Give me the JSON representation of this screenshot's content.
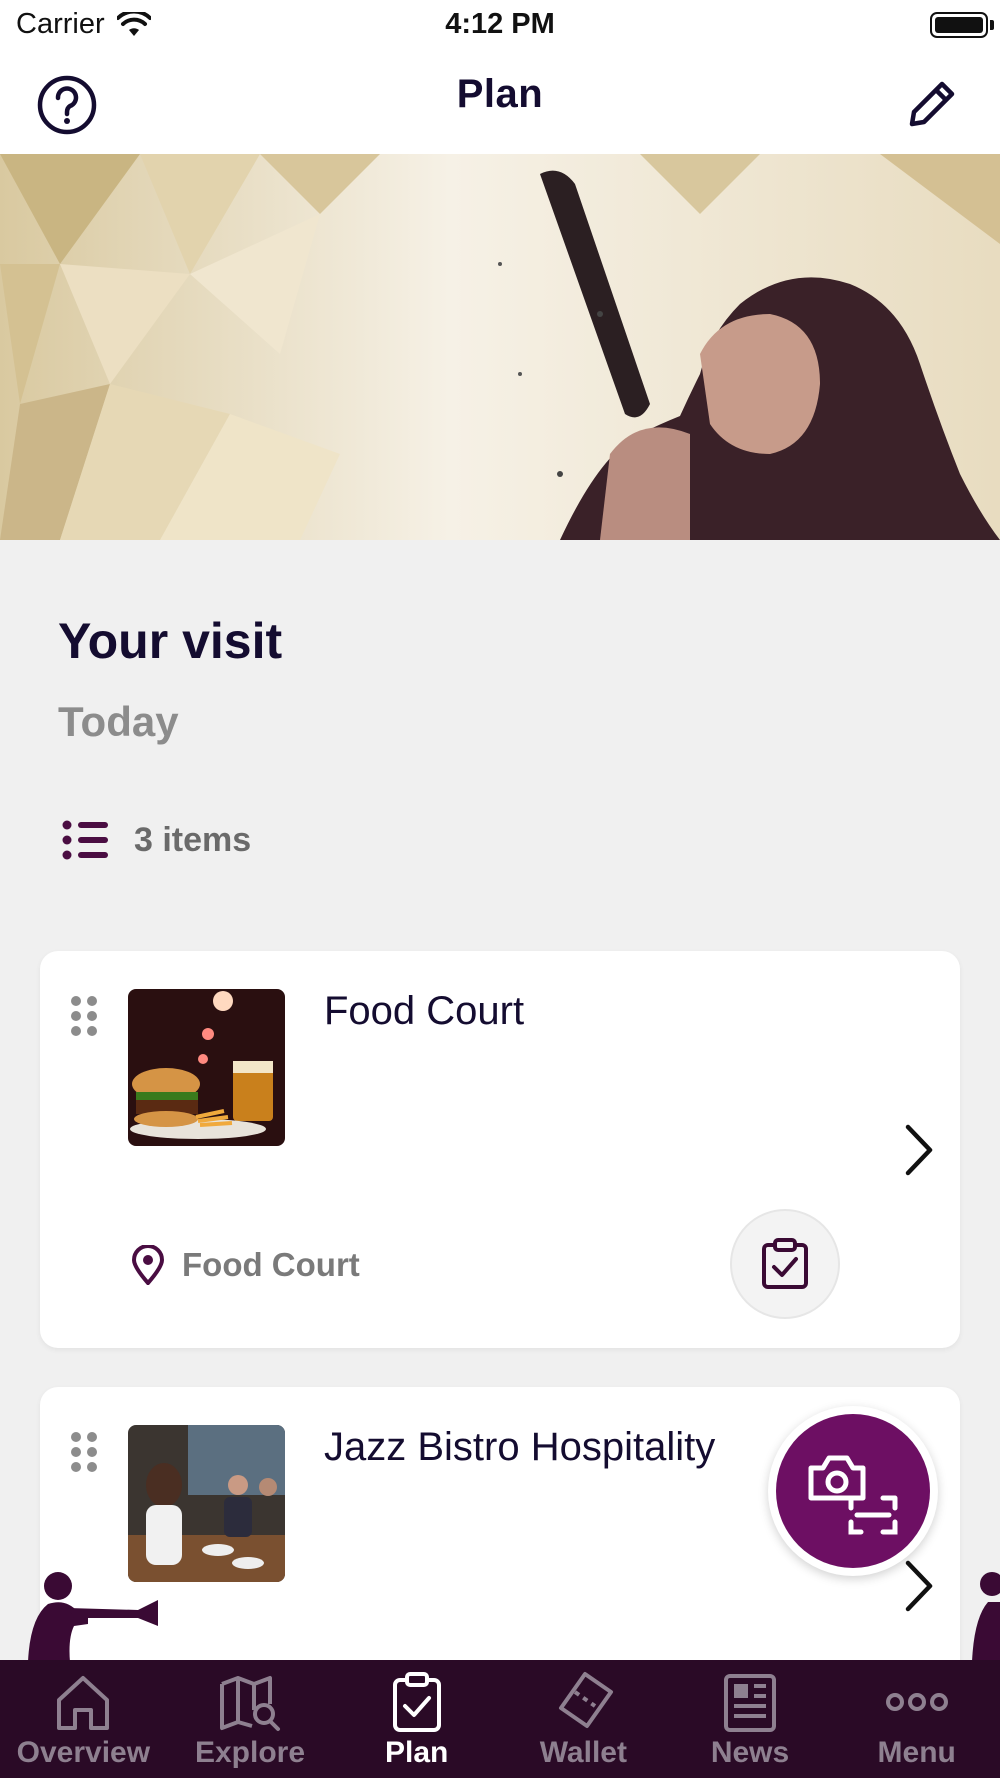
{
  "status_bar": {
    "carrier": "Carrier",
    "time": "4:12 PM"
  },
  "nav": {
    "title": "Plan",
    "left_icon": "help-icon",
    "right_icon": "edit-pencil-icon"
  },
  "hero": {
    "image": "singer-artwork"
  },
  "visit": {
    "title": "Your visit",
    "date": "Today",
    "items_count": "3 items"
  },
  "cards": [
    {
      "title": "Food Court",
      "thumbnail": "burger-and-beer-photo",
      "location": "Food Court",
      "action_icon": "clipboard-check-icon"
    },
    {
      "title": "Jazz Bistro Hospitality",
      "thumbnail": "diners-at-table-photo"
    }
  ],
  "fab": {
    "icon": "camera-scan-icon"
  },
  "tabs": [
    {
      "label": "Overview",
      "icon": "home-icon",
      "active": false
    },
    {
      "label": "Explore",
      "icon": "map-search-icon",
      "active": false
    },
    {
      "label": "Plan",
      "icon": "clipboard-check-icon",
      "active": true
    },
    {
      "label": "Wallet",
      "icon": "ticket-icon",
      "active": false
    },
    {
      "label": "News",
      "icon": "newspaper-icon",
      "active": false
    },
    {
      "label": "Menu",
      "icon": "more-dots-icon",
      "active": false
    }
  ],
  "colors": {
    "brand": "#6d0f63",
    "tab_bar": "#2a0a26",
    "title": "#140c30",
    "background": "#f0f0f0"
  }
}
